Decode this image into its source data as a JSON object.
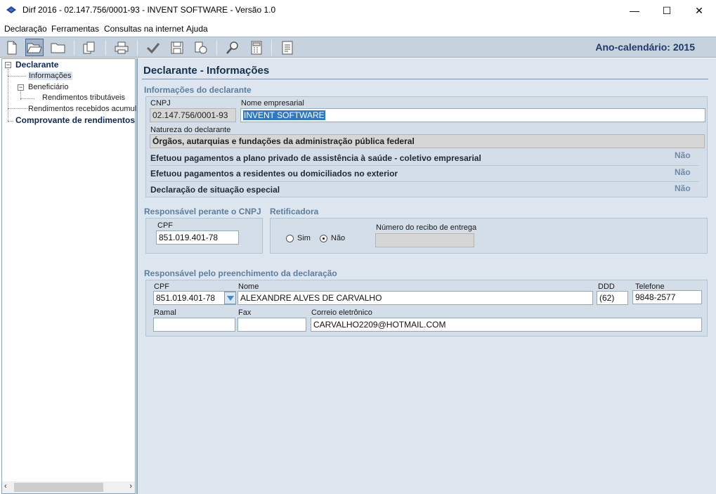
{
  "window": {
    "title": "Dirf 2016 - 02.147.756/0001-93 - INVENT SOFTWARE - Versão 1.0",
    "minimize": "—",
    "maximize": "☐",
    "close": "✕"
  },
  "menu": {
    "items": [
      "Declaração",
      "Ferramentas",
      "Consultas na internet",
      "Ajuda"
    ]
  },
  "toolbar": {
    "icons": [
      "new-document-icon",
      "open-folder-icon",
      "folder-icon",
      "copy-icon",
      "print-icon",
      "check-icon",
      "save-icon",
      "recover-icon",
      "search-icon",
      "calculator-icon",
      "receipt-icon"
    ],
    "ano_calendario": "Ano-calendário: 2015"
  },
  "tree": {
    "declarante": "Declarante",
    "informacoes": "Informações",
    "beneficiario": "Beneficiário",
    "rendimentos_tributaveis": "Rendimentos tributáveis",
    "rendimentos_acumulados": "Rendimentos recebidos acumula",
    "comprovante": "Comprovante de rendimentos"
  },
  "main": {
    "title": "Declarante - Informações",
    "informacoes": {
      "section_title": "Informações do declarante",
      "cnpj_label": "CNPJ",
      "cnpj_value": "02.147.756/0001-93",
      "nome_label": "Nome empresarial",
      "nome_value": "INVENT SOFTWARE",
      "natureza_label": "Natureza do declarante",
      "natureza_value": "Órgãos, autarquias e fundações da administração pública federal",
      "questions": [
        {
          "label": "Efetuou pagamentos a plano privado de assistência à saúde - coletivo empresarial",
          "value": "Não"
        },
        {
          "label": "Efetuou pagamentos a residentes ou domiciliados no exterior",
          "value": "Não"
        },
        {
          "label": "Declaração de situação especial",
          "value": "Não"
        }
      ]
    },
    "responsavel_cnpj": {
      "section_title": "Responsável perante o CNPJ",
      "cpf_label": "CPF",
      "cpf_value": "851.019.401-78"
    },
    "retificadora": {
      "section_title": "Retificadora",
      "sim_label": "Sim",
      "nao_label": "Não",
      "selected": "Não",
      "recibo_label": "Número do recibo de entrega",
      "recibo_value": ""
    },
    "responsavel_preenchimento": {
      "section_title": "Responsável pelo preenchimento da declaração",
      "cpf_label": "CPF",
      "cpf_value": "851.019.401-78",
      "nome_label": "Nome",
      "nome_value": "ALEXANDRE ALVES DE CARVALHO",
      "ddd_label": "DDD",
      "ddd_value": "(62)",
      "telefone_label": "Telefone",
      "telefone_value": "9848-2577",
      "ramal_label": "Ramal",
      "ramal_value": "",
      "fax_label": "Fax",
      "fax_value": "",
      "email_label": "Correio eletrônico",
      "email_value": "CARVALHO2209@HOTMAIL.COM"
    }
  },
  "colors": {
    "toolbar_bg": "#c6d3df",
    "main_bg": "#dde6ee",
    "section_title": "#5b7fa1",
    "selection": "#3178c6"
  }
}
